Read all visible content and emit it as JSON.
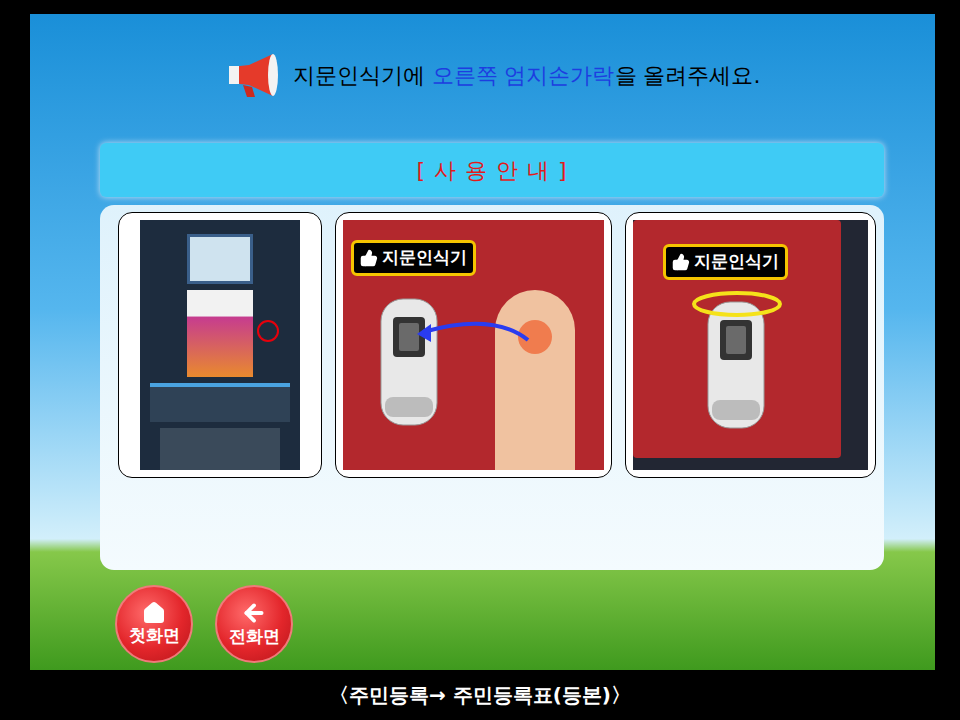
{
  "header": {
    "prefix": "지문인식기에 ",
    "highlight": "오른쪽 엄지손가락",
    "suffix": "을 올려주세요."
  },
  "guide": {
    "title": "[ 사 용 안 내 ]",
    "photos": [
      {
        "kind": "kiosk",
        "badge": ""
      },
      {
        "kind": "finger",
        "badge": "지문인식기"
      },
      {
        "kind": "reader",
        "badge": "지문인식기"
      }
    ]
  },
  "nav_buttons": [
    {
      "label": "첫화면",
      "kind": "home"
    },
    {
      "label": "전화면",
      "kind": "back"
    }
  ],
  "footer": "〈주민등록→ 주민등록표(등본)〉"
}
